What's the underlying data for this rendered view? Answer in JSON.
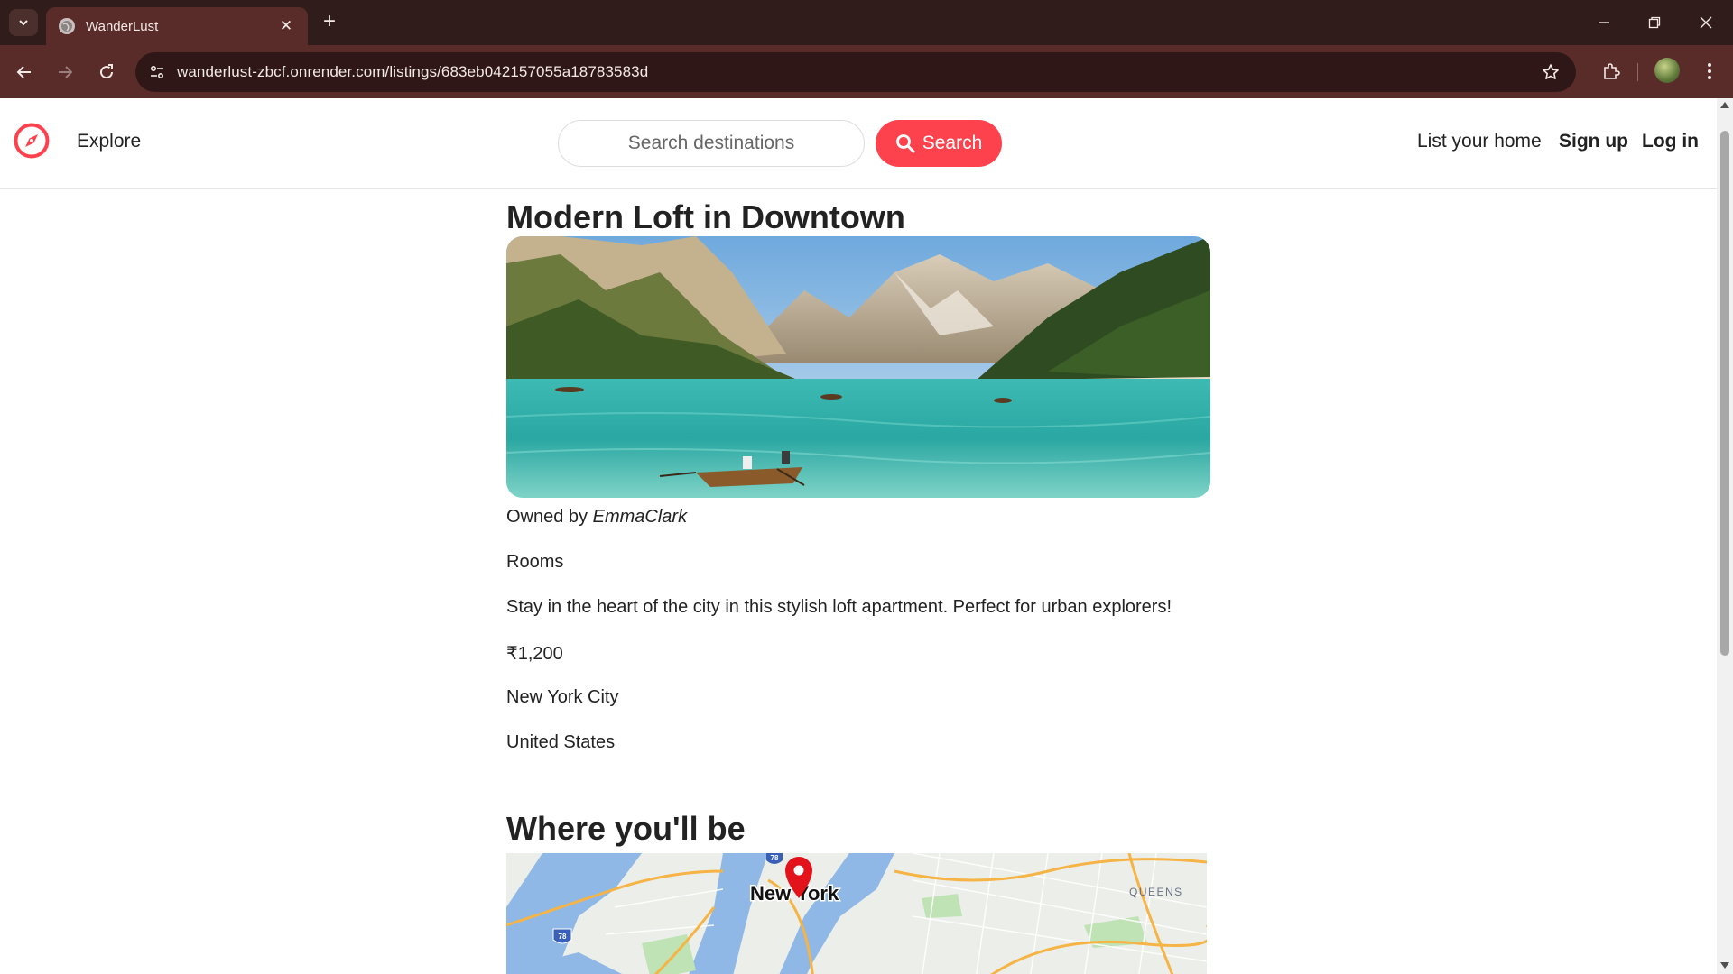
{
  "browser": {
    "tab_title": "WanderLust",
    "url": "wanderlust-zbcf.onrender.com/listings/683eb042157055a18783583d",
    "icons": [
      "tab-search-icon",
      "globe-icon",
      "close-icon",
      "plus-icon",
      "minimize-icon",
      "restore-icon",
      "close-window-icon",
      "back-icon",
      "forward-icon",
      "reload-icon",
      "site-info-icon",
      "bookmark-star-icon",
      "extensions-icon",
      "menu-kebab-icon"
    ]
  },
  "navbar": {
    "explore_label": "Explore",
    "search_placeholder": "Search destinations",
    "search_button_label": "Search",
    "list_home_label": "List your home",
    "signup_label": "Sign up",
    "login_label": "Log in",
    "brand_color": "#fe424d"
  },
  "listing": {
    "title": "Modern Loft in Downtown",
    "owned_by_label": "Owned by ",
    "owner_name": "EmmaClark",
    "category": "Rooms",
    "description": "Stay in the heart of the city in this stylish loft apartment. Perfect for urban explorers!",
    "price": "₹1,200",
    "location": "New York City",
    "country": "United States"
  },
  "map_section": {
    "heading": "Where you'll be",
    "city_label": "New York",
    "area_label": "QUEENS",
    "highway_labels": [
      "78",
      "78"
    ]
  }
}
